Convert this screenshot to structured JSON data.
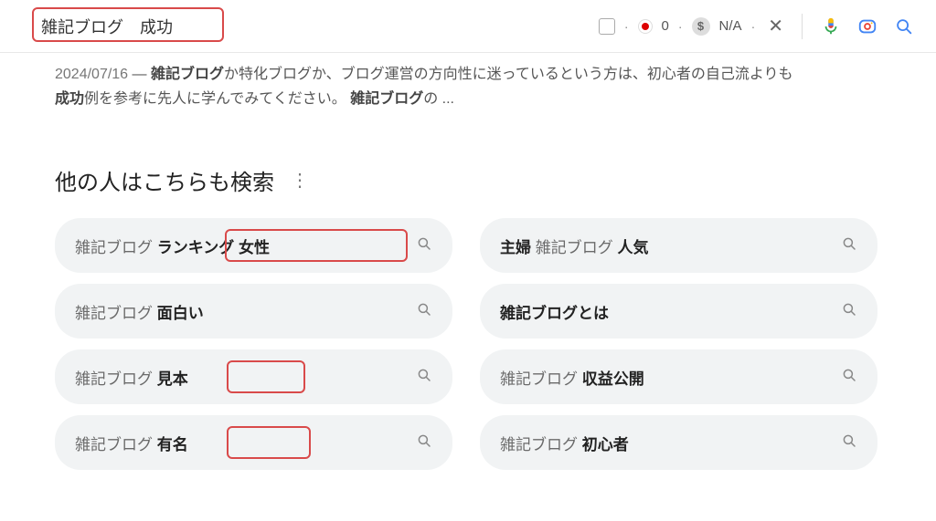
{
  "search": {
    "query": "雑記ブログ　成功",
    "counter_value": "0",
    "na_label": "N/A",
    "dollar_symbol": "$"
  },
  "snippet": {
    "date": "2024/07/16",
    "sep": " — ",
    "part1_bold": "雑記ブログ",
    "part1_rest": "か特化ブログか、ブログ運営の方向性に迷っているという方は、初心者の自己流よりも",
    "part2_bold": "成功",
    "part2_rest": "例を参考に先人に学んでみてください。 ",
    "part3_bold": "雑記ブログ",
    "part3_rest": "の ..."
  },
  "related": {
    "title": "他の人はこちらも検索",
    "items": [
      {
        "prefix": "雑記ブログ ",
        "bold": "ランキング 女性",
        "suffix": "",
        "highlight": "hl1"
      },
      {
        "prefix": "",
        "bold": "主婦",
        "suffix": " 雑記ブログ ",
        "bold2": "人気",
        "highlight": "hl4"
      },
      {
        "prefix": "雑記ブログ ",
        "bold": "面白い",
        "suffix": ""
      },
      {
        "prefix": "",
        "bold": "雑記ブログとは",
        "suffix": ""
      },
      {
        "prefix": "雑記ブログ ",
        "bold": "見本",
        "suffix": "",
        "highlight": "hl2"
      },
      {
        "prefix": "雑記ブログ ",
        "bold": "収益公開",
        "suffix": ""
      },
      {
        "prefix": "雑記ブログ ",
        "bold": "有名",
        "suffix": "",
        "highlight": "hl3"
      },
      {
        "prefix": "雑記ブログ ",
        "bold": "初心者",
        "suffix": ""
      }
    ]
  }
}
